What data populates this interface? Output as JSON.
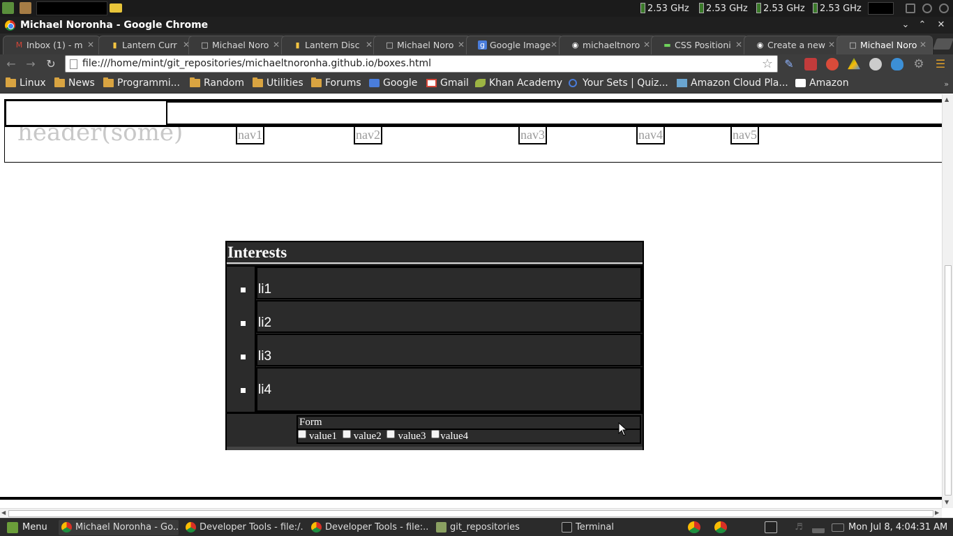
{
  "system_bar": {
    "cpu_freqs": [
      "2.53 GHz",
      "2.53 GHz",
      "2.53 GHz",
      "2.53 GHz"
    ]
  },
  "window": {
    "title": "Michael Noronha - Google Chrome"
  },
  "tabs": [
    {
      "label": "Inbox (1) - m",
      "icon": "gmail-icon"
    },
    {
      "label": "Lantern Curr",
      "icon": "lantern-icon"
    },
    {
      "label": "Michael Noro",
      "icon": "page-icon"
    },
    {
      "label": "Lantern Disc",
      "icon": "lantern-icon"
    },
    {
      "label": "Michael Noro",
      "icon": "page-icon"
    },
    {
      "label": "Google Image",
      "icon": "google-icon"
    },
    {
      "label": "michaeltnoro",
      "icon": "github-icon"
    },
    {
      "label": "CSS Positioni",
      "icon": "css-icon"
    },
    {
      "label": "Create a new",
      "icon": "github-icon"
    },
    {
      "label": "Michael Noro",
      "icon": "page-icon",
      "active": true
    }
  ],
  "toolbar": {
    "url": "file:///home/mint/git_repositories/michaeltnoronha.github.io/boxes.html"
  },
  "bookmarks": [
    {
      "label": "Linux",
      "icon": "folder-icon"
    },
    {
      "label": "News",
      "icon": "folder-icon"
    },
    {
      "label": "Programmi...",
      "icon": "folder-icon"
    },
    {
      "label": "Random",
      "icon": "folder-icon"
    },
    {
      "label": "Utilities",
      "icon": "folder-icon"
    },
    {
      "label": "Forums",
      "icon": "folder-icon"
    },
    {
      "label": "Google",
      "icon": "google-icon"
    },
    {
      "label": "Gmail",
      "icon": "gmail-icon"
    },
    {
      "label": "Khan Academy",
      "icon": "khan-icon"
    },
    {
      "label": "Your Sets | Quiz...",
      "icon": "quizlet-icon"
    },
    {
      "label": "Amazon Cloud Pla...",
      "icon": "amazon-cloud-icon"
    },
    {
      "label": "Amazon",
      "icon": "amazon-icon"
    }
  ],
  "page": {
    "header_text": "header(some)",
    "nav": [
      "nav1",
      "nav2",
      "nav3",
      "nav4",
      "nav5"
    ],
    "interests_title": "Interests",
    "interests": [
      "li1",
      "li2",
      "li3",
      "li4"
    ],
    "form_title": "Form",
    "form_values": [
      "value1",
      "value2",
      "value3",
      "value4"
    ]
  },
  "taskbar": {
    "menu_label": "Menu",
    "tasks": [
      {
        "label": "Michael Noronha - Go...",
        "icon": "chrome-icon",
        "active": true
      },
      {
        "label": "Developer Tools - file:/...",
        "icon": "chrome-icon"
      },
      {
        "label": "Developer Tools - file:...",
        "icon": "chrome-icon"
      },
      {
        "label": "git_repositories",
        "icon": "folder-icon"
      },
      {
        "label": "Terminal",
        "icon": "terminal-icon"
      }
    ],
    "clock": "Mon Jul  8,  4:04:31 AM"
  },
  "colors": {
    "panel_bg": "#2b2b2b",
    "chrome_dark": "#3d3d3d",
    "folder": "#d9a441"
  }
}
